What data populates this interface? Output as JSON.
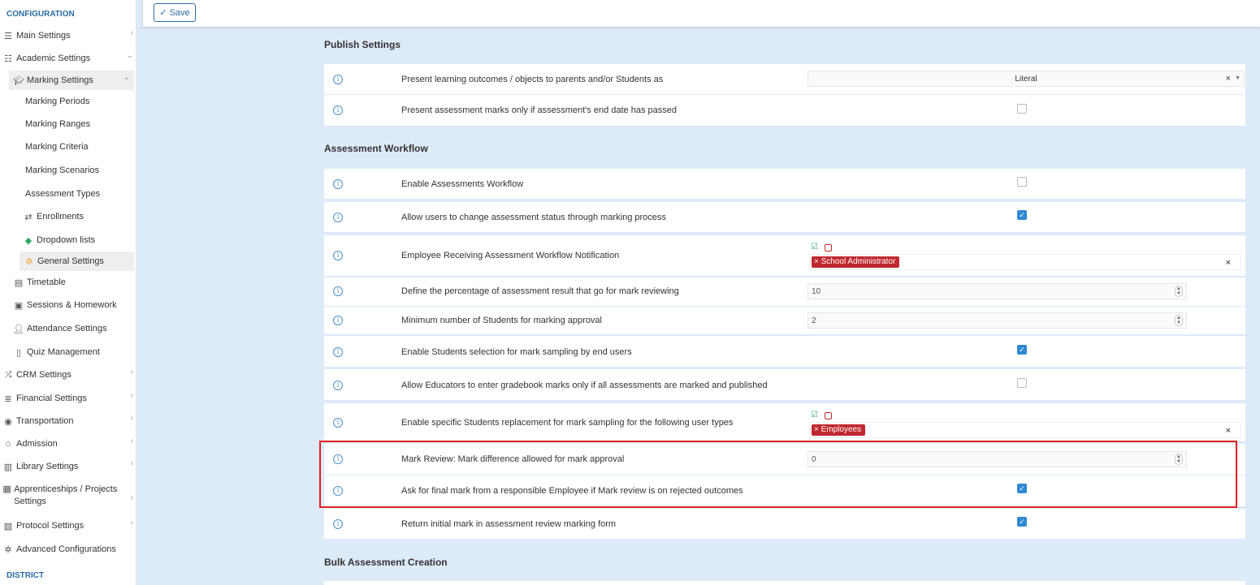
{
  "sidebar": {
    "configuration_header": "CONFIGURATION",
    "district_header": "DISTRICT",
    "items": [
      {
        "label": "Main Settings",
        "icon": "sliders-icon"
      },
      {
        "label": "Academic Settings",
        "icon": "sitemap-icon"
      },
      {
        "label": "Marking Settings",
        "icon": "graduation-cap-icon"
      },
      {
        "label": "Marking Periods"
      },
      {
        "label": "Marking Ranges"
      },
      {
        "label": "Marking Criteria"
      },
      {
        "label": "Marking Scenarios"
      },
      {
        "label": "Assessment Types"
      },
      {
        "label": "Enrollments",
        "icon": "exchange-icon"
      },
      {
        "label": "Dropdown lists",
        "icon": "layers-icon"
      },
      {
        "label": "General Settings",
        "icon": "gear-icon"
      },
      {
        "label": "Timetable",
        "icon": "calendar-icon"
      },
      {
        "label": "Sessions & Homework",
        "icon": "teacher-icon"
      },
      {
        "label": "Attendance Settings",
        "icon": "user-clock-icon"
      },
      {
        "label": "Quiz Management",
        "icon": "file-icon"
      },
      {
        "label": "CRM Settings",
        "icon": "shuffle-icon"
      },
      {
        "label": "Financial Settings",
        "icon": "coins-icon"
      },
      {
        "label": "Transportation",
        "icon": "bus-icon"
      },
      {
        "label": "Admission",
        "icon": "building-icon"
      },
      {
        "label": "Library Settings",
        "icon": "books-icon"
      },
      {
        "label": "Apprenticeships / Projects Settings",
        "icon": "box-icon"
      },
      {
        "label": "Protocol Settings",
        "icon": "protocol-icon"
      },
      {
        "label": "Advanced Configurations",
        "icon": "gears-icon"
      }
    ]
  },
  "toolbar": {
    "save_label": "Save"
  },
  "sections": {
    "publish": {
      "title": "Publish Settings",
      "rows": [
        {
          "label": "Present learning outcomes / objects to parents and/or Students as",
          "select_value": "Literal"
        },
        {
          "label": "Present assessment marks only if assessment's end date has passed",
          "checked": false
        }
      ]
    },
    "workflow": {
      "title": "Assessment Workflow",
      "rows": [
        {
          "label": "Enable Assessments Workflow",
          "checked": false
        },
        {
          "label": "Allow users to change assessment status through marking process",
          "checked": true
        },
        {
          "label": "Employee Receiving Assessment Workflow Notification",
          "tag": "School Administrator"
        },
        {
          "label": "Define the percentage of assessment result that go for mark reviewing",
          "value": "10"
        },
        {
          "label": "Minimum number of Students for marking approval",
          "value": "2"
        },
        {
          "label": "Enable Students selection for mark sampling by end users",
          "checked": true
        },
        {
          "label": "Allow Educators to enter gradebook marks only if all assessments are marked and published",
          "checked": false
        },
        {
          "label": "Enable specific Students replacement for mark sampling for the following user types",
          "tag": "Employees"
        },
        {
          "label": "Mark Review: Mark difference allowed for mark approval",
          "value": "0"
        },
        {
          "label": "Ask for final mark from a responsible Employee if Mark review is on rejected outcomes",
          "checked": true
        },
        {
          "label": "Return initial mark in assessment review marking form",
          "checked": true
        }
      ]
    },
    "bulk": {
      "title": "Bulk Assessment Creation"
    }
  }
}
